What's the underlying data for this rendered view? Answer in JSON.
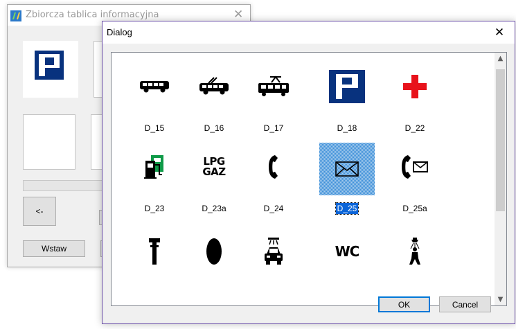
{
  "background_window": {
    "title": "Zbiorcza tablica informacyjna",
    "prev_button_label": "<-",
    "insert_button_label": "Wstaw",
    "preview_icon": "parking-sign-icon"
  },
  "dialog": {
    "title": "Dialog",
    "ok_label": "OK",
    "cancel_label": "Cancel",
    "selected_item": "D_25",
    "items": [
      {
        "label": "D_15",
        "icon": "bus-icon"
      },
      {
        "label": "D_16",
        "icon": "trolleybus-icon"
      },
      {
        "label": "D_17",
        "icon": "tram-icon"
      },
      {
        "label": "D_18",
        "icon": "parking-sign-icon",
        "color": "#08327e"
      },
      {
        "label": "D_22",
        "icon": "first-aid-cross-icon",
        "color": "#e8121b"
      },
      {
        "label": "D_23",
        "icon": "fuel-pump-icon",
        "color": "#0f9a48"
      },
      {
        "label": "D_23a",
        "icon": "lpg-gas-icon",
        "text": "LPG\nGAZ"
      },
      {
        "label": "D_24",
        "icon": "telephone-icon"
      },
      {
        "label": "D_25",
        "icon": "envelope-icon"
      },
      {
        "label": "D_25a",
        "icon": "telephone-envelope-icon"
      },
      {
        "label": "",
        "icon": "t-post-icon"
      },
      {
        "label": "",
        "icon": "tire-icon"
      },
      {
        "label": "",
        "icon": "car-wash-icon"
      },
      {
        "label": "",
        "icon": "wc-icon",
        "text": "WC"
      },
      {
        "label": "",
        "icon": "shower-icon"
      }
    ]
  }
}
